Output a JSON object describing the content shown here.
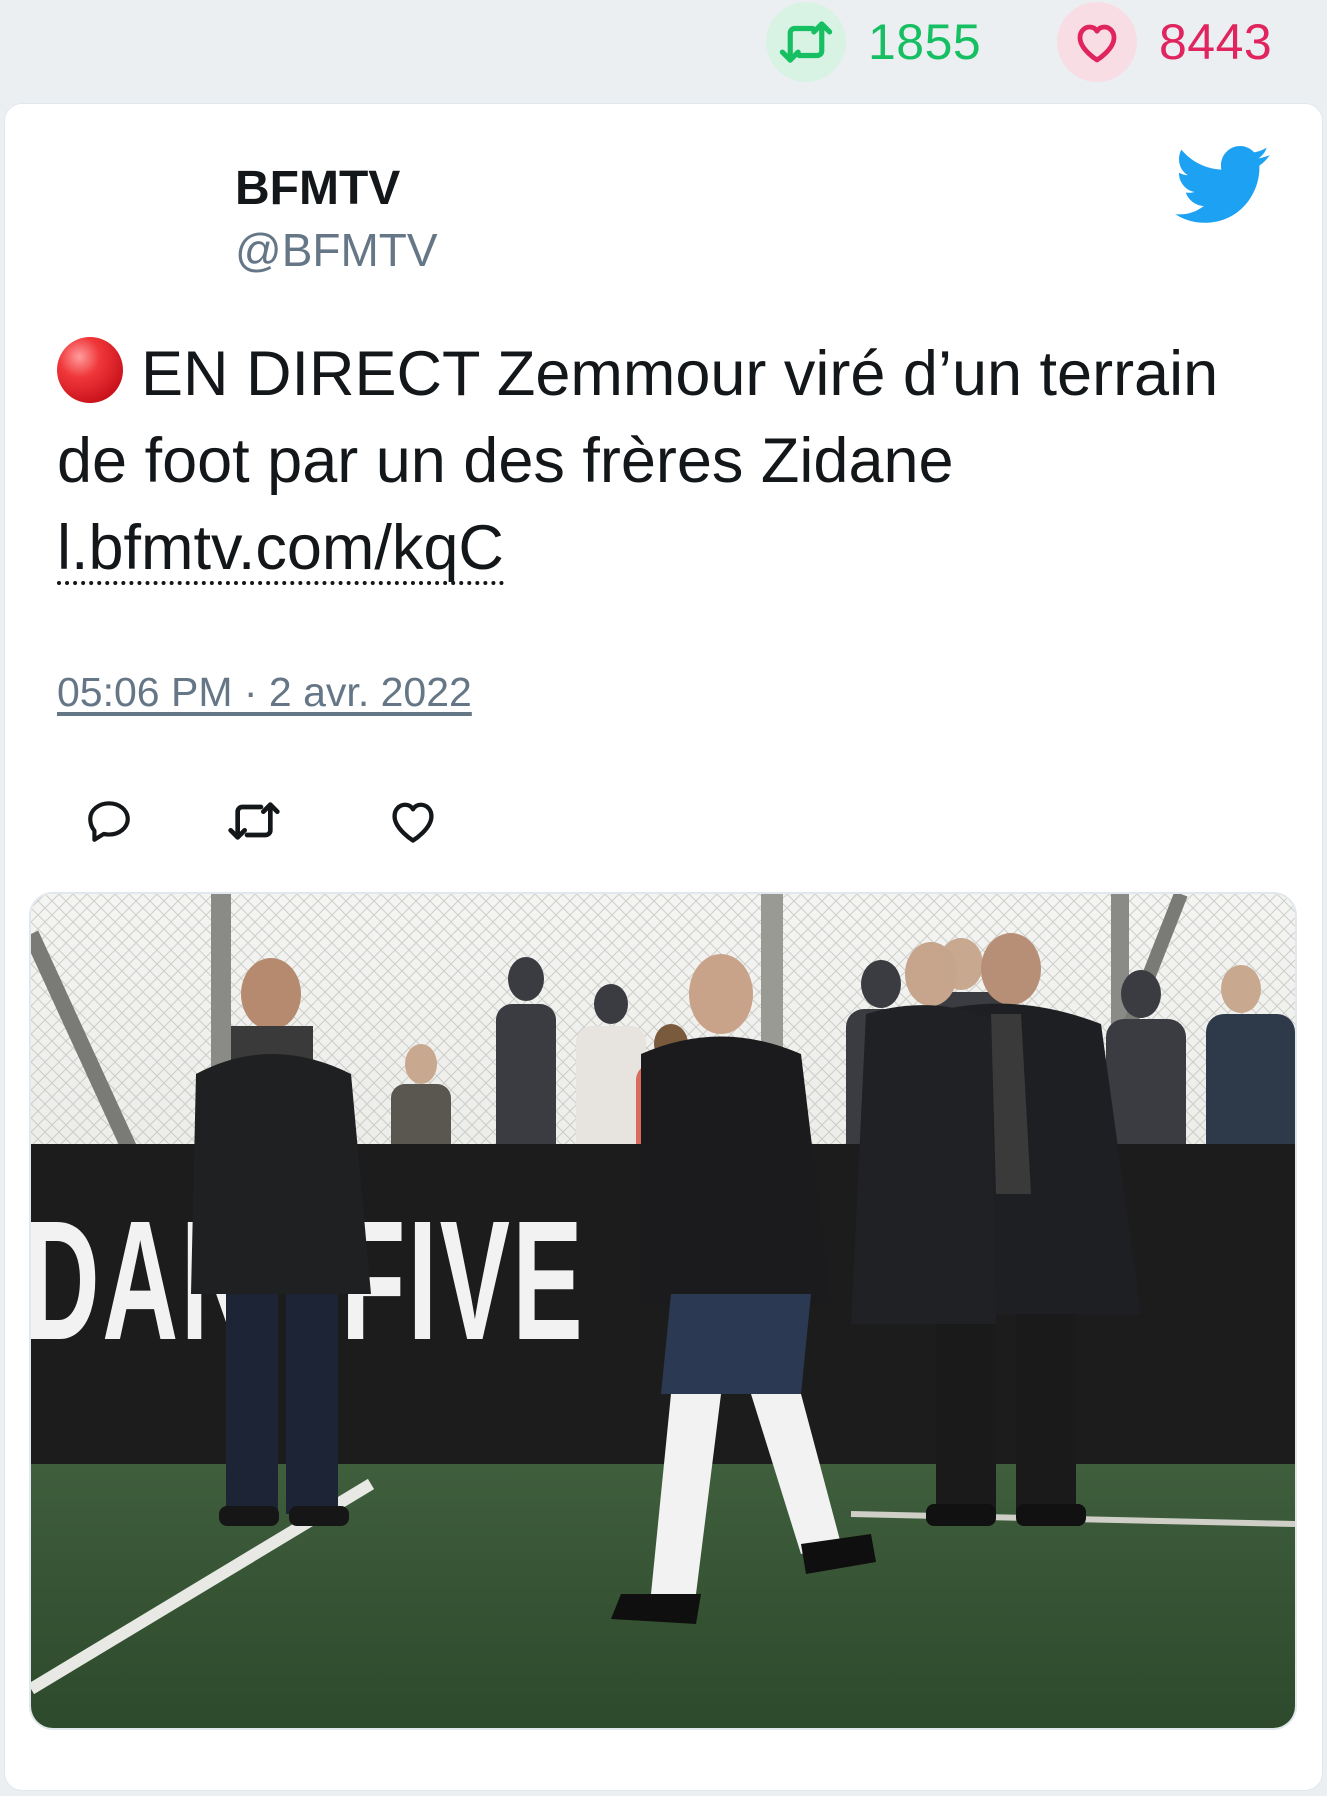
{
  "stats": {
    "retweets": "1855",
    "likes": "8443"
  },
  "tweet": {
    "author_name": "BFMTV",
    "author_handle": "@BFMTV",
    "text": "EN DIRECT Zemmour viré d’un terrain de foot par un des frères Zidane",
    "link": "l.bfmtv.com/kqC",
    "timestamp": "05:06 PM · 2 avr. 2022"
  },
  "media": {
    "banner_text": "DAN FIVE",
    "description": "Photo"
  },
  "colors": {
    "retweet_green": "#17bf63",
    "like_red": "#e0245e",
    "twitter_blue": "#1da1f2",
    "muted_gray": "#657786"
  },
  "icons": [
    "retweet-icon",
    "heart-icon",
    "twitter-bird-icon",
    "live-red-dot-icon",
    "reply-icon"
  ]
}
